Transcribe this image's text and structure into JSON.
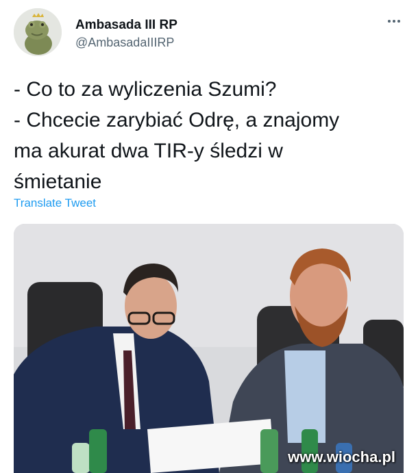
{
  "tweet": {
    "author": {
      "display_name": "Ambasada III RP",
      "handle": "@AmbasadaIIIRP",
      "avatar": "frog-plush-avatar"
    },
    "menu_icon": "more-dots-icon",
    "text_lines": [
      "- Co to za wyliczenia Szumi?",
      "- Chcecie zarybiać Odrę, a znajomy",
      "ma akurat dwa TIR-y śledzi w",
      "śmietanie"
    ],
    "translate_label": "Translate Tweet",
    "media": {
      "description_icon": "photo-two-men-meeting",
      "watermark": "www.wiocha.pl"
    }
  },
  "colors": {
    "text": "#0f1419",
    "secondary": "#536471",
    "link": "#1d9bf0",
    "background": "#ffffff"
  }
}
